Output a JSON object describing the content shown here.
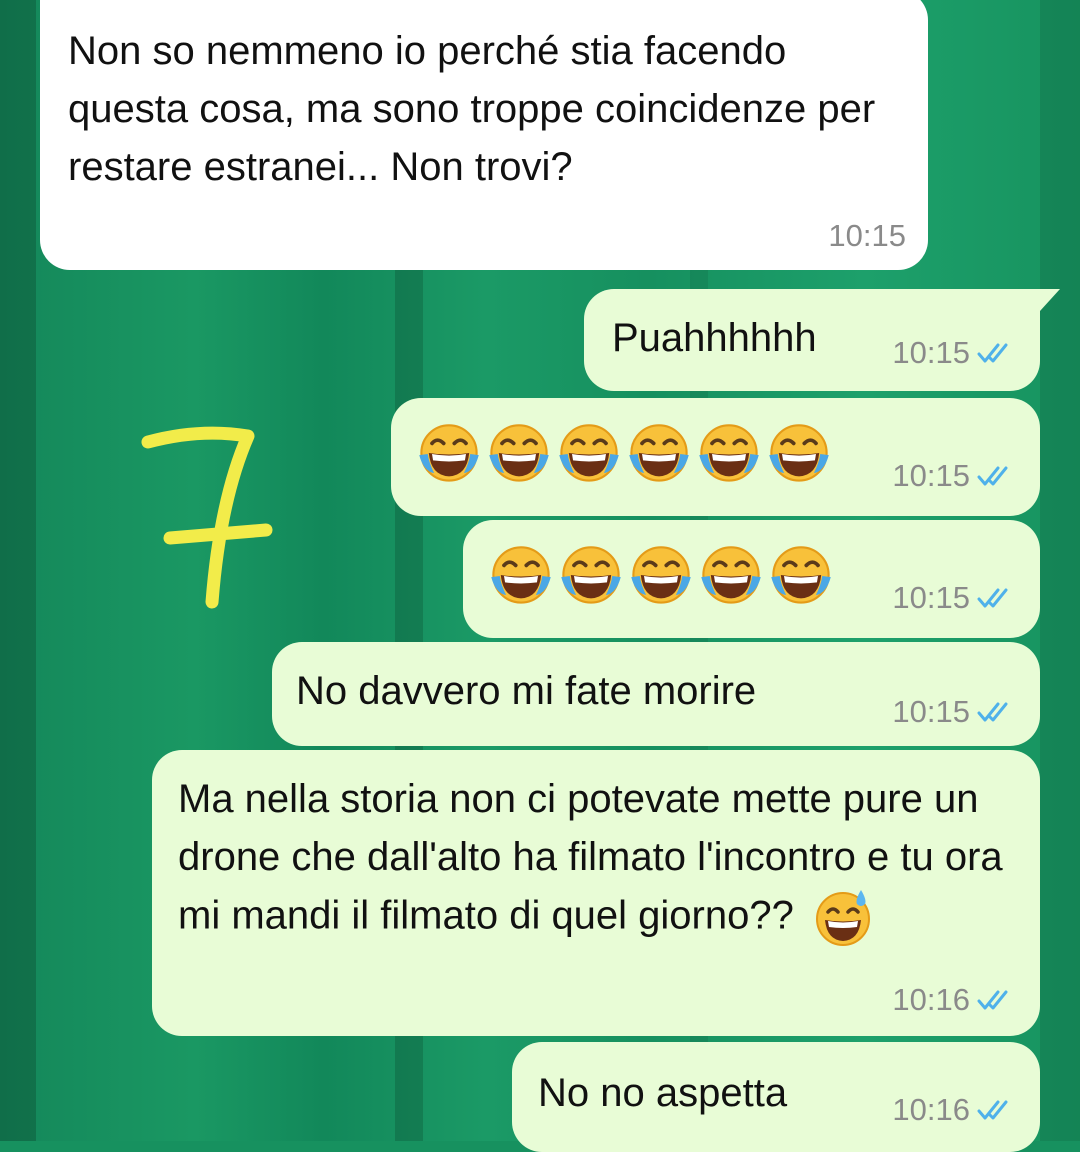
{
  "wallpaper_color": "#17915f",
  "incoming_bubble_color": "#ffffff",
  "outgoing_bubble_color": "#e8fcd6",
  "read_tick_color": "#4fb1ea",
  "annotation": {
    "text": "7",
    "color": "#f2ec4a"
  },
  "messages": [
    {
      "direction": "incoming",
      "text": "Non so nemmeno io perché stia facendo questa cosa, ma sono troppe coincidenze per restare estranei... Non trovi?",
      "time": "10:15"
    },
    {
      "direction": "outgoing",
      "text": "Puahhhhhh",
      "time": "10:15",
      "status": "read"
    },
    {
      "direction": "outgoing",
      "emoji": "face-with-tears-of-joy",
      "emoji_count": 6,
      "time": "10:15",
      "status": "read"
    },
    {
      "direction": "outgoing",
      "emoji": "face-with-tears-of-joy",
      "emoji_count": 5,
      "time": "10:15",
      "status": "read"
    },
    {
      "direction": "outgoing",
      "text": "No davvero mi fate morire",
      "time": "10:15",
      "status": "read"
    },
    {
      "direction": "outgoing",
      "text": "Ma nella storia non ci potevate mette pure un drone che dall'alto ha filmato l'incontro e tu ora mi mandi il filmato di quel giorno??",
      "trailing_emoji": "grinning-face-with-sweat",
      "time": "10:16",
      "status": "read"
    },
    {
      "direction": "outgoing",
      "text": "No no aspetta",
      "time": "10:16",
      "status": "read"
    }
  ]
}
